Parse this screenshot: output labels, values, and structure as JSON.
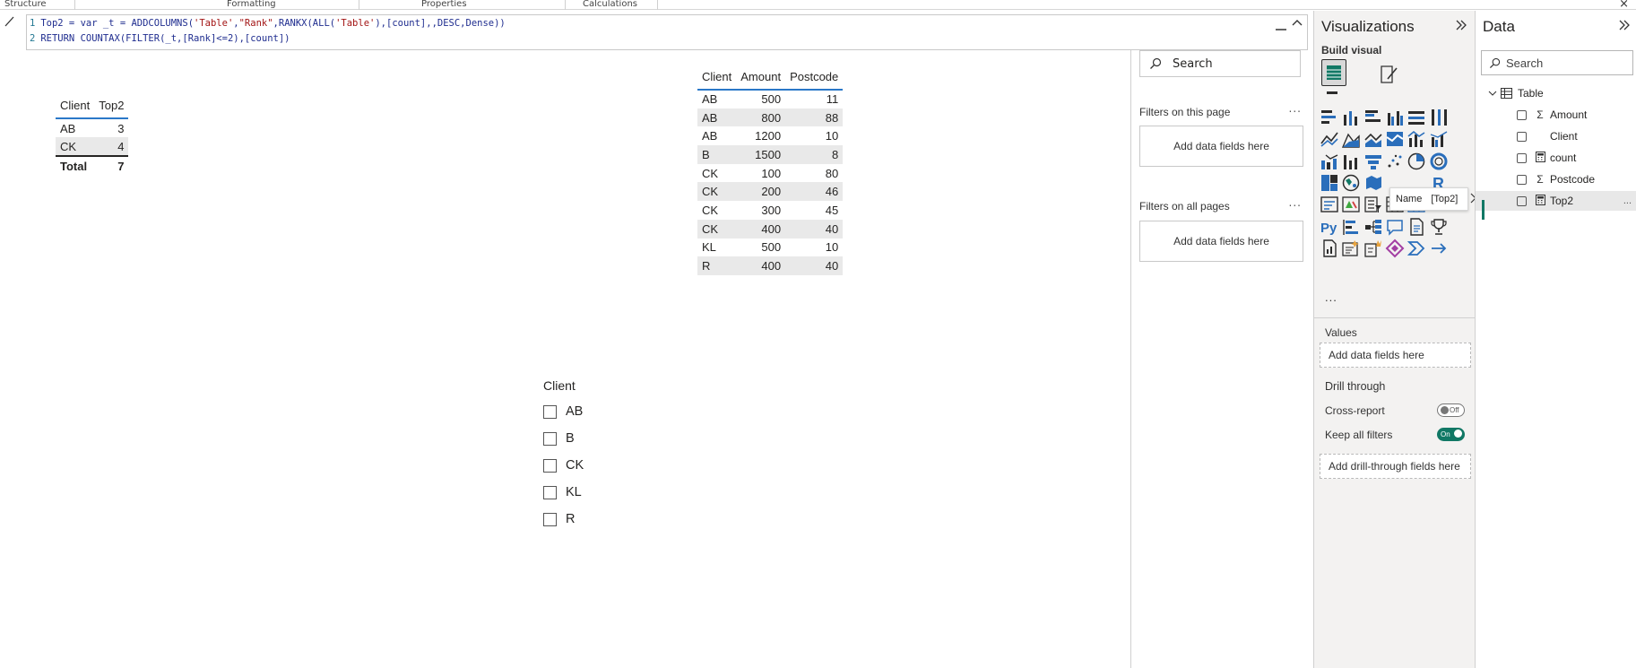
{
  "ribbon": {
    "items": [
      "Structure",
      "Formatting",
      "Properties",
      "Calculations"
    ],
    "close_glyph": "×"
  },
  "formula": {
    "line1_num": "1",
    "line2_num": "2",
    "line1": "Top2 = var _t = ADDCOLUMNS('Table',\"Rank\",RANKX(ALL('Table'),[count],,DESC,Dense))",
    "line2": "RETURN COUNTAX(FILTER(_t,[Rank]<=2),[count])"
  },
  "top2_table": {
    "headers": [
      "Client",
      "Top2"
    ],
    "rows": [
      [
        "AB",
        "3"
      ],
      [
        "CK",
        "4"
      ]
    ],
    "total": [
      "Total",
      "7"
    ]
  },
  "main_table": {
    "headers": [
      "Client",
      "Amount",
      "Postcode"
    ],
    "rows": [
      [
        "AB",
        "500",
        "11"
      ],
      [
        "AB",
        "800",
        "88"
      ],
      [
        "AB",
        "1200",
        "10"
      ],
      [
        "B",
        "1500",
        "8"
      ],
      [
        "CK",
        "100",
        "80"
      ],
      [
        "CK",
        "200",
        "46"
      ],
      [
        "CK",
        "300",
        "45"
      ],
      [
        "CK",
        "400",
        "40"
      ],
      [
        "KL",
        "500",
        "10"
      ],
      [
        "R",
        "400",
        "40"
      ]
    ]
  },
  "slicer": {
    "title": "Client",
    "items": [
      "AB",
      "B",
      "CK",
      "KL",
      "R"
    ]
  },
  "filters": {
    "search_placeholder": "Search",
    "this_page": "Filters on this page",
    "all_pages": "Filters on all pages",
    "add_fields": "Add data fields here",
    "more": "..."
  },
  "visualizations": {
    "title": "Visualizations",
    "build_visual": "Build visual",
    "tooltip_name": "Name",
    "tooltip_value": "[Top2]",
    "more": "...",
    "values_label": "Values",
    "values_add": "Add data fields here",
    "drill_through": "Drill through",
    "cross_report": "Cross-report",
    "cross_report_state": "Off",
    "keep_all_filters": "Keep all filters",
    "keep_all_filters_state": "On",
    "drill_add": "Add drill-through fields here",
    "python_label": "Py",
    "r_label": "R",
    "accent": "#117865"
  },
  "data_pane": {
    "title": "Data",
    "search_placeholder": "Search",
    "table_name": "Table",
    "fields": [
      {
        "name": "Amount",
        "icon": "sigma-icon"
      },
      {
        "name": "Client",
        "icon": "none"
      },
      {
        "name": "count",
        "icon": "calculator-icon"
      },
      {
        "name": "Postcode",
        "icon": "sigma-icon"
      },
      {
        "name": "Top2",
        "icon": "calculator-icon"
      }
    ],
    "more": "..."
  }
}
